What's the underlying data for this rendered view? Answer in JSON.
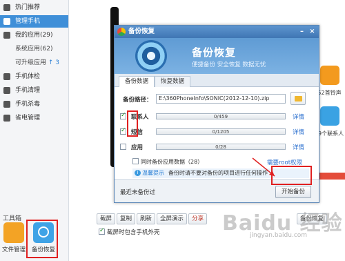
{
  "sidebar": {
    "items": [
      {
        "label": "热门推荐",
        "icon": "star-icon"
      },
      {
        "label": "管理手机",
        "icon": "phone-icon",
        "active": true
      },
      {
        "label": "我的应用(29)",
        "icon": "apps-icon"
      },
      {
        "label": "系统应用(62)"
      },
      {
        "label": "可升级应用",
        "badge": "↑ 3"
      },
      {
        "label": "手机体检",
        "icon": "checkup-icon"
      },
      {
        "label": "手机清理",
        "icon": "broom-icon"
      },
      {
        "label": "手机杀毒",
        "icon": "shield-icon"
      },
      {
        "label": "省电管理",
        "icon": "battery-icon"
      }
    ],
    "toolbox_title": "工具箱",
    "tools": [
      {
        "label": "文件管理",
        "icon": "folder-icon"
      },
      {
        "label": "备份恢复",
        "icon": "backup-restore-icon"
      }
    ]
  },
  "right_panel": {
    "ringtone_label": "52首铃声",
    "contacts_label": "459个联系人"
  },
  "bottom_bar": {
    "buttons": [
      "截屏",
      "复制",
      "刷新",
      "全屏演示",
      "分享"
    ],
    "right_buttons": [
      "备份恢复"
    ],
    "screenshot_option": "截屏时包含手机外壳"
  },
  "dialog": {
    "title": "备份恢复",
    "header_title": "备份恢复",
    "header_subtitle": "便捷备份 安全恢复 数据无忧",
    "tabs": [
      "备份数据",
      "恢复数据"
    ],
    "path_label": "备份路径：",
    "path_value": "E:\\360PhoneInfo\\SONIC(2012-12-10).zip",
    "rows": [
      {
        "label": "联系人",
        "progress": "0/459",
        "checked": true,
        "detail": "详情"
      },
      {
        "label": "短信",
        "progress": "0/1205",
        "checked": true,
        "detail": "详情"
      },
      {
        "label": "应用",
        "progress": "0/28",
        "checked": false,
        "detail": "详情"
      }
    ],
    "sync_label": "同时备份应用数据（28）",
    "root_link": "需要root权限",
    "tip_title": "温馨提示",
    "tip_text": "备份时请不要对备份的项目进行任何操作",
    "last_backup": "最近未备份过",
    "start_button": "开始备份"
  },
  "watermark": {
    "text": "Baidu 经验",
    "sub": "jingyan.baidu.com"
  },
  "colors": {
    "accent": "#3f8fd8",
    "highlight_box": "#e02020",
    "title_bar": "#4a83c0"
  }
}
